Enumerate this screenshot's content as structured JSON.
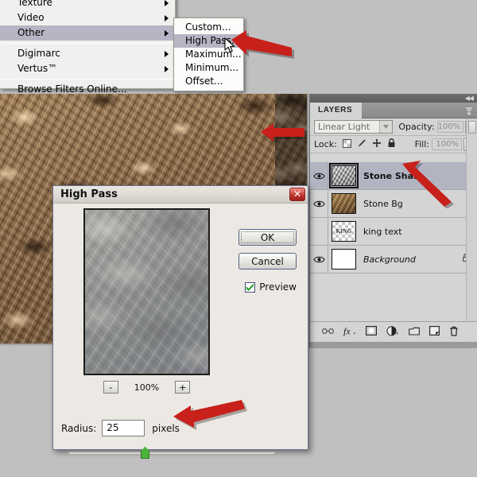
{
  "app": {
    "name": "Adobe Photoshop",
    "accent_red": "#c8201a",
    "highlight_blue": "#b5b5c4",
    "panel_gray": "#d4d4d4"
  },
  "filter_menu": {
    "name": "Filter menu (Other submenu open)",
    "items": [
      {
        "label": "Texture",
        "has_submenu": true,
        "selected": false,
        "separator_after": false
      },
      {
        "label": "Video",
        "has_submenu": true,
        "selected": false,
        "separator_after": false
      },
      {
        "label": "Other",
        "has_submenu": true,
        "selected": true,
        "separator_after": true
      },
      {
        "label": "Digimarc",
        "has_submenu": true,
        "selected": false,
        "separator_after": false
      },
      {
        "label": "Vertus™",
        "has_submenu": true,
        "selected": false,
        "separator_after": true
      },
      {
        "label": "Browse Filters Online...",
        "has_submenu": false,
        "selected": false,
        "separator_after": false
      }
    ]
  },
  "other_submenu": {
    "name": "Other filters submenu",
    "items": [
      {
        "label": "Custom...",
        "selected": false
      },
      {
        "label": "High Pass...",
        "selected": true
      },
      {
        "label": "Maximum...",
        "selected": false
      },
      {
        "label": "Minimum...",
        "selected": false
      },
      {
        "label": "Offset...",
        "selected": false
      }
    ]
  },
  "dialog": {
    "title": "High Pass",
    "close_glyph": "✕",
    "buttons": {
      "ok": "OK",
      "cancel": "Cancel"
    },
    "preview": {
      "label": "Preview",
      "checked": true,
      "check_glyph": "✓"
    },
    "zoom": {
      "level": "100%",
      "minus": "-",
      "plus": "+"
    },
    "radius": {
      "label": "Radius:",
      "value": "25",
      "unit": "pixels",
      "slider_percent": 35
    }
  },
  "layers_panel": {
    "tab_label": "LAYERS",
    "collapse_icon": "◀◀",
    "blend_mode": "Linear Light",
    "opacity": {
      "label": "Opacity:",
      "value": "100%"
    },
    "fill": {
      "label": "Fill:",
      "value": "100%"
    },
    "lock": {
      "label": "Lock:",
      "icons": [
        "transparency-lock-icon",
        "paintbrush-lock-icon",
        "move-lock-icon",
        "lock-all-icon"
      ]
    },
    "layers": [
      {
        "name": "Stone Sharp",
        "visible": true,
        "selected": true,
        "bold": true,
        "italic": false,
        "locked": false,
        "thumb": "stone-sharp",
        "thumb_text": ""
      },
      {
        "name": "Stone Bg",
        "visible": true,
        "selected": false,
        "bold": false,
        "italic": false,
        "locked": false,
        "thumb": "stone-bg",
        "thumb_text": ""
      },
      {
        "name": "king text",
        "visible": false,
        "selected": false,
        "bold": false,
        "italic": false,
        "locked": false,
        "thumb": "checker",
        "thumb_text": "KING"
      },
      {
        "name": "Background",
        "visible": true,
        "selected": false,
        "bold": false,
        "italic": true,
        "locked": true,
        "thumb": "white",
        "thumb_text": ""
      }
    ],
    "bottom_icons": [
      "link-layers-icon",
      "layer-style-fx-icon",
      "add-mask-icon",
      "adjustment-layer-icon",
      "new-group-folder-icon",
      "new-layer-icon",
      "delete-layer-trash-icon"
    ]
  },
  "annotations": {
    "arrows": [
      {
        "name": "arrow-to-high-pass-menu-item",
        "direction": "left",
        "target": "High Pass... menu item"
      },
      {
        "name": "arrow-to-canvas",
        "direction": "left",
        "target": "document canvas"
      },
      {
        "name": "arrow-to-stone-sharp-layer",
        "direction": "up-left",
        "target": "Stone Sharp layer"
      },
      {
        "name": "arrow-to-radius-field",
        "direction": "left",
        "target": "Radius field"
      }
    ]
  },
  "cursor": {
    "name": "mouse-pointer",
    "over": "High Pass... menu item"
  }
}
